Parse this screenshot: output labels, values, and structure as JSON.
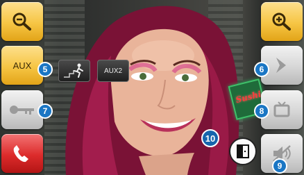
{
  "left_buttons": {
    "zoom_out_icon": "zoom-out-icon",
    "aux_label": "AUX",
    "key_icon": "key-icon",
    "hangup_icon": "hang-up-phone-icon"
  },
  "right_buttons": {
    "zoom_in_icon": "zoom-in-icon",
    "next_icon": "chevron-right-icon",
    "tv_icon": "monitor-icon",
    "mute_icon": "speaker-mute-icon"
  },
  "overlay": {
    "stairs_icon": "stairs-light-icon",
    "aux2_label": "AUX2",
    "door_icon": "door-icon",
    "neon_sign_text": "Sushi"
  },
  "callouts": [
    "5",
    "6",
    "7",
    "8",
    "9",
    "10"
  ],
  "colors": {
    "orange_button": "#f6c544",
    "grey_button": "#d6d6d6",
    "red_button": "#dc2b2b",
    "callout_blue": "#1a76c4"
  }
}
